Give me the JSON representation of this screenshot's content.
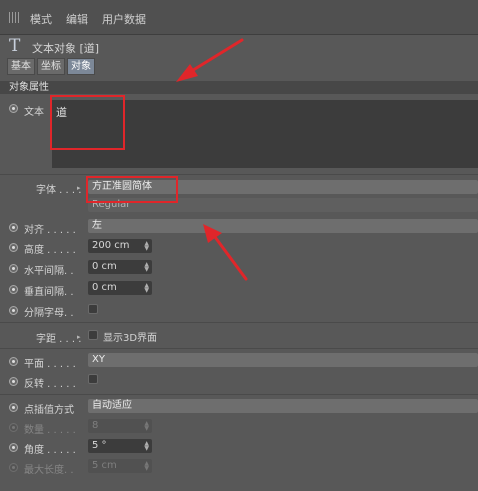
{
  "menu": {
    "items": [
      "模式",
      "编辑",
      "用户数据"
    ]
  },
  "object": {
    "title": "文本对象 [道]"
  },
  "tabs": [
    {
      "label": "基本",
      "active": false
    },
    {
      "label": "坐标",
      "active": false
    },
    {
      "label": "对象",
      "active": true
    }
  ],
  "section": {
    "title": "对象属性"
  },
  "text_param": {
    "label": "文本",
    "value": "道"
  },
  "font": {
    "label": "字体 . . . .",
    "family": "方正准圆简体",
    "style": "Regular"
  },
  "params": {
    "align": {
      "label": "对齐 . . . . .",
      "value": "左"
    },
    "height": {
      "label": "高度 . . . . .",
      "value": "200 cm"
    },
    "hspace": {
      "label": "水平间隔. .",
      "value": "0 cm"
    },
    "vspace": {
      "label": "垂直间隔. .",
      "value": "0 cm"
    },
    "sepletters": {
      "label": "分隔字母. .",
      "checked": false
    }
  },
  "kerning": {
    "label": "字距 . . . .",
    "show3d_label": "显示3D界面",
    "checked": false
  },
  "plane": {
    "label": "平面 . . . . .",
    "value": "XY"
  },
  "reverse": {
    "label": "反转 . . . . .",
    "checked": false
  },
  "interp": {
    "label": "点插值方式",
    "value": "自动适应",
    "count": {
      "label": "数量 . . . . .",
      "value": "8"
    },
    "angle": {
      "label": "角度 . . . . .",
      "value": "5 °"
    },
    "maxlen": {
      "label": "最大长度. .",
      "value": "5 cm"
    }
  },
  "colors": {
    "annotation": "#e0262a",
    "active_tab": "#7c8898"
  }
}
